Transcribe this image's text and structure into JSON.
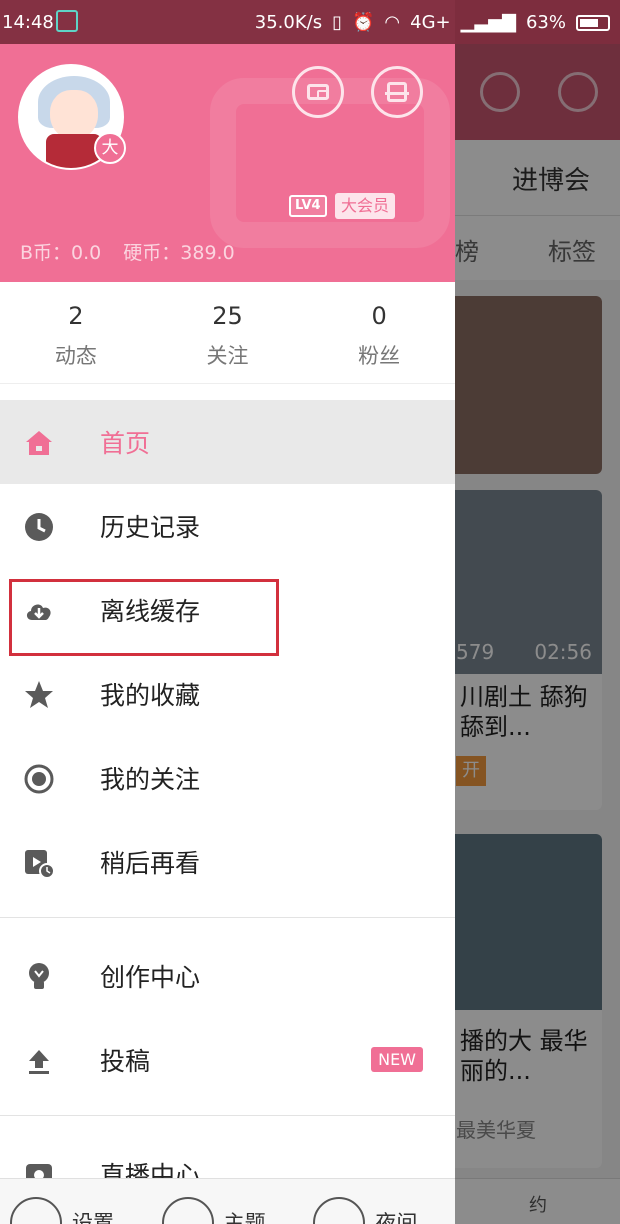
{
  "status_bar": {
    "time": "14:48",
    "speed": "35.0K/s",
    "network": "4G+",
    "battery": "63%"
  },
  "background_app": {
    "tab": "进博会",
    "sub_left": "榜",
    "sub_right": "标签",
    "card2": {
      "views": "579",
      "duration": "02:56",
      "title": "川剧土 舔狗舔到...",
      "tag": "开"
    },
    "card3": {
      "title": "播的大 最华丽的...",
      "tag": "最美华夏"
    },
    "bottom_tab": "约"
  },
  "drawer": {
    "avatar_badge": "大",
    "level": "LV4",
    "vip": "大会员",
    "b_coins": "B币：0.0",
    "coins": "硬币：389.0",
    "stats": [
      {
        "value": "2",
        "label": "动态"
      },
      {
        "value": "25",
        "label": "关注"
      },
      {
        "value": "0",
        "label": "粉丝"
      }
    ],
    "menu": {
      "home": "首页",
      "history": "历史记录",
      "offline": "离线缓存",
      "favorites": "我的收藏",
      "following": "我的关注",
      "watch_later": "稍后再看",
      "creator": "创作中心",
      "upload": "投稿",
      "upload_badge": "NEW",
      "live": "直播中心"
    },
    "bottom": {
      "settings": "设置",
      "theme": "主题",
      "night": "夜间"
    }
  },
  "colors": {
    "accent": "#f06f95",
    "highlight": "#d2303d"
  }
}
